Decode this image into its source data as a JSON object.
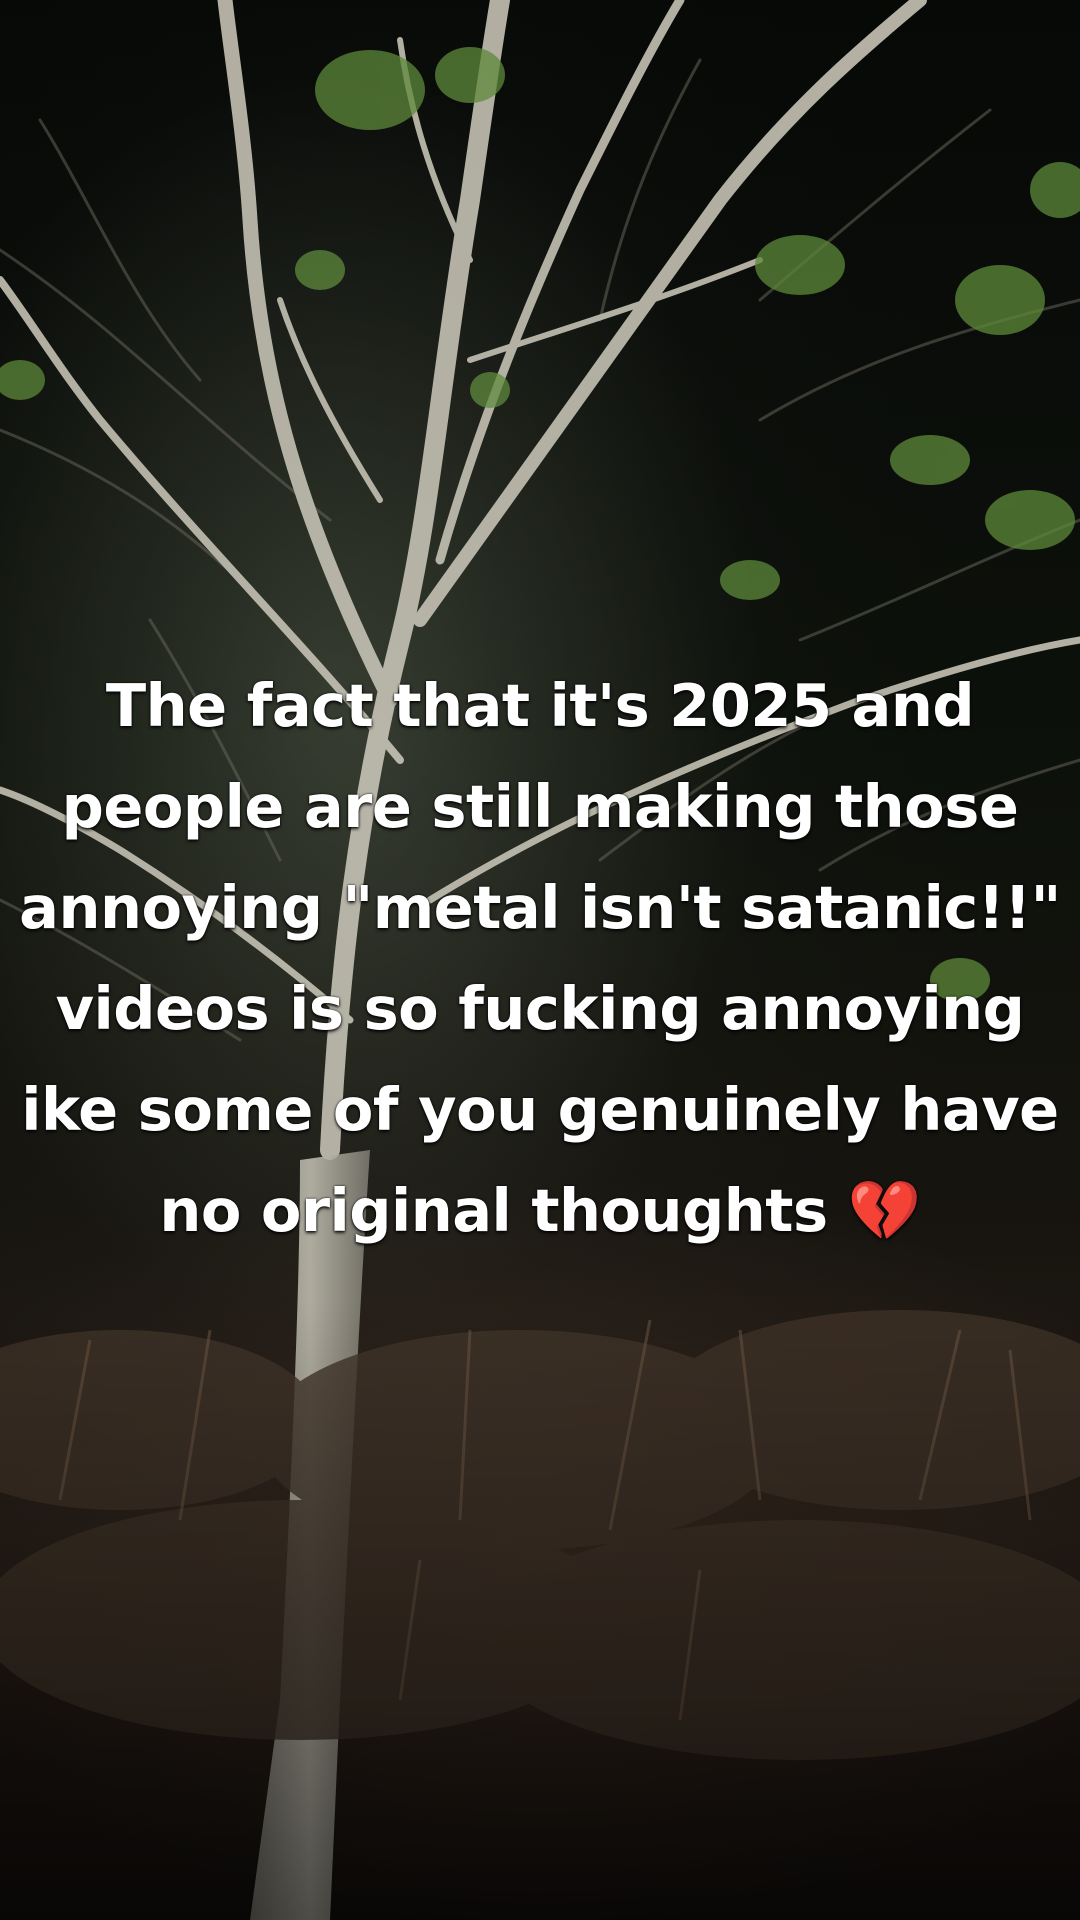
{
  "caption": {
    "lines": [
      "The fact that it's 2025 and",
      "people are still making those",
      "annoying \"metal isn't satanic!!\"",
      "videos is so fucking annoying",
      "ike some of you genuinely have",
      "no original thoughts"
    ],
    "emoji": "💔",
    "emoji_name": "broken-heart-emoji",
    "text_color": "#ffffff"
  },
  "scene": {
    "subject": "night-tree-bare-branches",
    "colors": {
      "sky": "#070907",
      "trunk": "#b9b6a8",
      "leaves": "#5e8a3a",
      "brush": "#4a3a2c"
    }
  }
}
